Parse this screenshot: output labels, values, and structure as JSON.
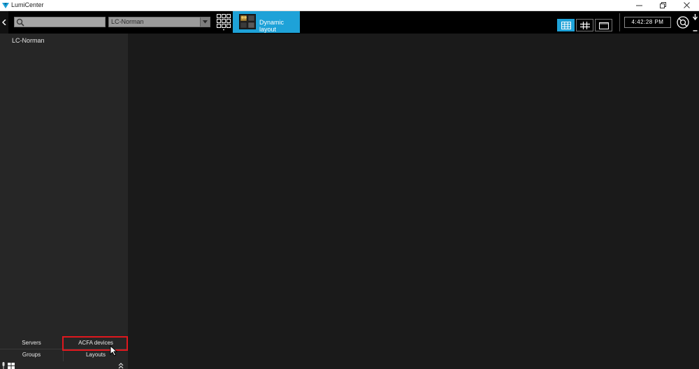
{
  "window": {
    "title": "LumiCenter",
    "controls": [
      "minimize-icon",
      "maximize-icon",
      "close-icon"
    ]
  },
  "toolbar": {
    "search_placeholder": "",
    "server_select_value": "LC-Norman",
    "layout_button_label": "Dynamic layout",
    "view_modes": [
      "grid-view-icon",
      "hash-view-icon",
      "single-view-icon"
    ],
    "active_view_mode": "grid",
    "clock": "4:42:28 PM"
  },
  "sidebar": {
    "tree": [
      {
        "label": "LC-Norman"
      }
    ],
    "tabs": {
      "servers": "Servers",
      "acfa_devices": "ACFA devices",
      "groups": "Groups",
      "layouts": "Layouts"
    },
    "highlighted_tab": "ACFA devices"
  },
  "colors": {
    "accent": "#1ea2d8",
    "highlight": "#e0181e",
    "background": "#1a1a1a",
    "sidebar": "#262626"
  }
}
